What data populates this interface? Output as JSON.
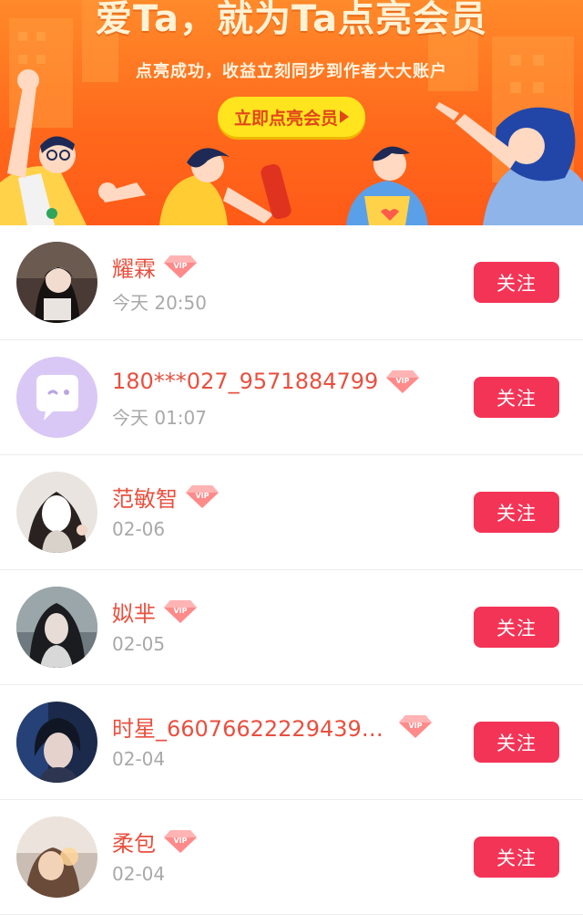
{
  "banner": {
    "title": "爱Ta，就为Ta点亮会员",
    "subtitle": "点亮成功，收益立刻同步到作者大大账户",
    "cta_label": "立即点亮会员"
  },
  "colors": {
    "name": "#e8503f",
    "time": "#a9a9a9",
    "follow_button": "#f43456",
    "cta_button": "#ffe41e",
    "banner": "#ff6a1c"
  },
  "members": [
    {
      "name": "耀霖",
      "time": "今天 20:50",
      "vip_icon": "vip-diamond-icon",
      "follow_label": "关注"
    },
    {
      "name": "180***027_9571884799",
      "time": "今天 01:07",
      "vip_icon": "vip-diamond-icon",
      "follow_label": "关注"
    },
    {
      "name": "范敏智",
      "time": "02-06",
      "vip_icon": "vip-diamond-icon",
      "follow_label": "关注"
    },
    {
      "name": "姒芈",
      "time": "02-05",
      "vip_icon": "vip-diamond-icon",
      "follow_label": "关注"
    },
    {
      "name": "时星_66076622229439…",
      "time": "02-04",
      "vip_icon": "vip-diamond-icon",
      "follow_label": "关注"
    },
    {
      "name": "柔包",
      "time": "02-04",
      "vip_icon": "vip-diamond-icon",
      "follow_label": "关注"
    }
  ]
}
